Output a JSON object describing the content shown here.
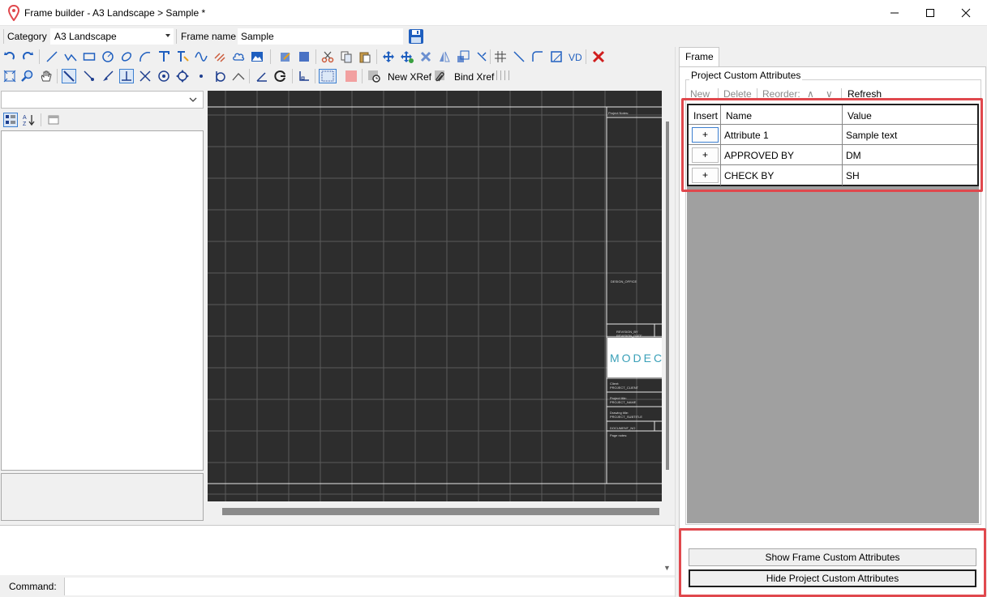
{
  "window": {
    "title": "Frame builder - A3 Landscape > Sample *"
  },
  "category_row": {
    "category_label": "Category",
    "category_value": "A3 Landscape",
    "frame_name_label": "Frame name",
    "frame_name_value": "Sample"
  },
  "toolbar": {
    "new_xref_label": "New XRef",
    "bind_xref_label": "Bind Xref"
  },
  "canvas": {
    "title_block": {
      "project_notes": "Project Notes:",
      "design_office": "DESIGN_OFFICE",
      "revision_by": "REVISION_BY",
      "revision_date": "REVISION_DATE",
      "logo_text": "MODEC",
      "client_label": "Client:",
      "client_value": "PROJECT_CLIENT",
      "project_title_label": "Project title:",
      "project_title_value": "PROJECT_NAME",
      "drawing_title_label": "Drawing title:",
      "drawing_title_value": "PROJECT_SUBTITLE",
      "document_no": "DOCUMENT_NO",
      "page_notes": "Page notes:"
    }
  },
  "command": {
    "label": "Command:"
  },
  "right_panel": {
    "tab_label": "Frame",
    "group_title": "Project Custom Attributes",
    "toolbar": {
      "new": "New",
      "delete": "Delete",
      "reorder": "Reorder:",
      "up": "∧",
      "down": "∨",
      "refresh": "Refresh"
    },
    "table": {
      "headers": [
        "Insert",
        "Name",
        "Value"
      ],
      "insert_symbol": "+",
      "rows": [
        {
          "name": "Attribute 1",
          "value": "Sample text"
        },
        {
          "name": "APPROVED BY",
          "value": "DM"
        },
        {
          "name": "CHECK BY",
          "value": "SH"
        }
      ]
    },
    "show_frame_button": "Show Frame Custom Attributes",
    "hide_project_button": "Hide Project Custom Attributes"
  },
  "colors": {
    "highlight": "#e0484d",
    "canvas_bg": "#2d2d2d",
    "accent_blue": "#1f5fbf"
  }
}
